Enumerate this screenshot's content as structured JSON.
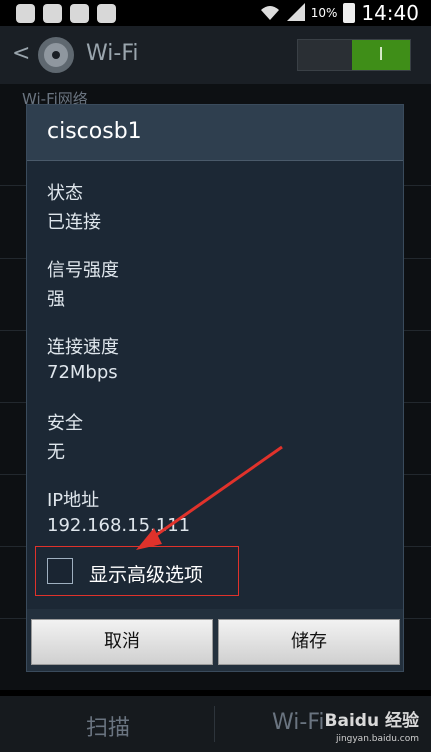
{
  "status_bar": {
    "icons": [
      "sync-icon",
      "shield-icon",
      "image-icon",
      "app-icon",
      "wifi-icon",
      "signal-icon",
      "battery-icon"
    ],
    "battery_percent": "10%",
    "time": "14:40"
  },
  "action_bar": {
    "back_glyph": "<",
    "title": "Wi-Fi",
    "toggle_label": "I"
  },
  "list": {
    "section_header": "Wi-Fi网络"
  },
  "dialog": {
    "title": "ciscosb1",
    "fields": [
      {
        "label": "状态",
        "value": "已连接"
      },
      {
        "label": "信号强度",
        "value": "强"
      },
      {
        "label": "连接速度",
        "value": "72Mbps"
      },
      {
        "label": "安全",
        "value": "无"
      },
      {
        "label": "IP地址",
        "value": "192.168.15.111"
      }
    ],
    "advanced_option_label": "显示高级选项",
    "cancel_label": "取消",
    "save_label": "储存"
  },
  "bottom_bar": {
    "scan_label": "扫描",
    "wifi_direct_label": "Wi-Fi"
  },
  "watermark": {
    "brand": "Baidu 经验",
    "url": "jingyan.baidu.com"
  },
  "colors": {
    "toggle_on": "#3f8e18",
    "annotation": "#e0322b"
  }
}
